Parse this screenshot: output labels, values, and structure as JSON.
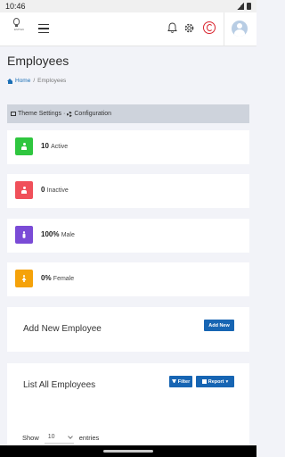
{
  "statusbar": {
    "time": "10:46"
  },
  "topbar": {
    "logo_text": "EMTEK"
  },
  "page": {
    "title": "Employees",
    "breadcrumb": {
      "home": "Home",
      "separator": "/",
      "current": "Employees"
    }
  },
  "themebar": {
    "theme_label": "Theme Settings",
    "separator": "·",
    "config_label": "Configuration"
  },
  "stats": [
    {
      "value": "10",
      "label": "Active",
      "color": "#2fc63f"
    },
    {
      "value": "0",
      "label": "Inactive",
      "color": "#f0505a"
    },
    {
      "value": "100%",
      "label": "Male",
      "color": "#7a4bd6"
    },
    {
      "value": "0%",
      "label": "Female",
      "color": "#f5a20a"
    }
  ],
  "add_card": {
    "title": "Add New Employee",
    "button": "Add New"
  },
  "list_card": {
    "title": "List All Employees",
    "filter_button": "Filter",
    "report_button": "Report",
    "show_label": "Show",
    "entries_value": "10",
    "entries_label": "entries"
  },
  "colors": {
    "primary": "#1765b3",
    "brand_red": "#d9232d",
    "accent_blue": "#1b6fb5"
  }
}
